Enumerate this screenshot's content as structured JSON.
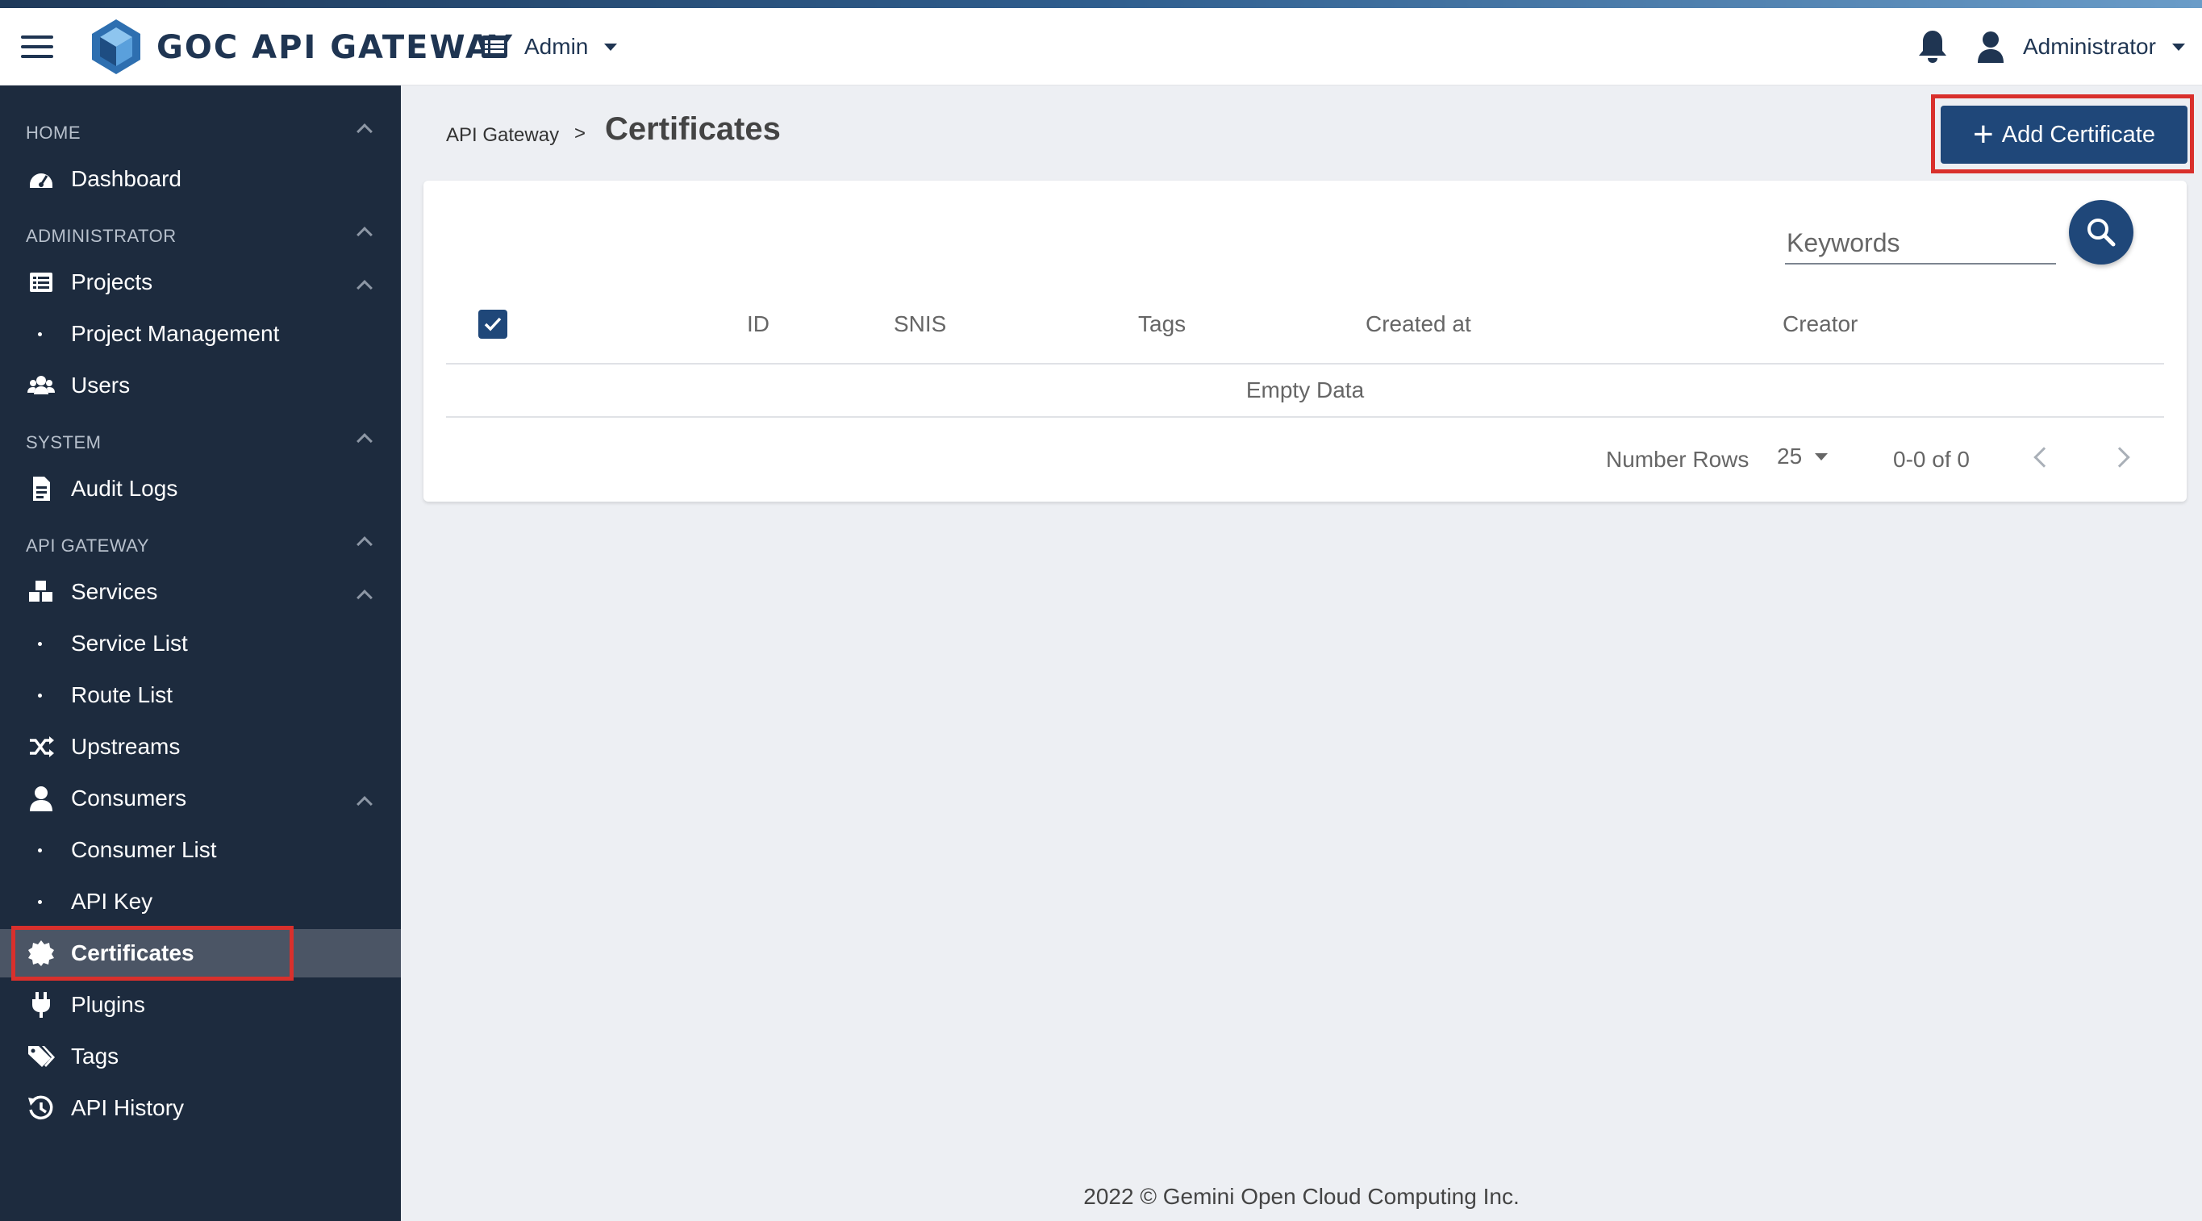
{
  "header": {
    "brand": "GOC API GATEWAY",
    "switcher_label": "Admin",
    "user_label": "Administrator"
  },
  "sidebar": {
    "sections": [
      "HOME",
      "ADMINISTRATOR",
      "SYSTEM",
      "API GATEWAY"
    ],
    "items": [
      {
        "label": "Dashboard",
        "icon": "dashboard-icon"
      },
      {
        "label": "Projects",
        "icon": "list-icon"
      },
      {
        "label": "Project Management",
        "icon": "bullet"
      },
      {
        "label": "Users",
        "icon": "users-icon"
      },
      {
        "label": "Audit Logs",
        "icon": "document-icon"
      },
      {
        "label": "Services",
        "icon": "cubes-icon"
      },
      {
        "label": "Service List",
        "icon": "bullet"
      },
      {
        "label": "Route List",
        "icon": "bullet"
      },
      {
        "label": "Upstreams",
        "icon": "shuffle-icon"
      },
      {
        "label": "Consumers",
        "icon": "user-icon"
      },
      {
        "label": "Consumer List",
        "icon": "bullet"
      },
      {
        "label": "API Key",
        "icon": "bullet"
      },
      {
        "label": "Certificates",
        "icon": "certificate-icon",
        "active": true
      },
      {
        "label": "Plugins",
        "icon": "plug-icon"
      },
      {
        "label": "Tags",
        "icon": "tags-icon"
      },
      {
        "label": "API History",
        "icon": "history-icon"
      }
    ]
  },
  "breadcrumb": {
    "parent": "API Gateway",
    "separator": ">",
    "current": "Certificates"
  },
  "add_button": "Add Certificate",
  "search": {
    "placeholder": "Keywords"
  },
  "table": {
    "columns": [
      "ID",
      "SNIS",
      "Tags",
      "Created at",
      "Creator"
    ],
    "empty_text": "Empty Data"
  },
  "pagination": {
    "rows_label": "Number Rows",
    "rows_value": "25",
    "range": "0-0 of 0"
  },
  "footer": "2022 © Gemini Open Cloud Computing Inc.",
  "colors": {
    "sidebar": "#1d2b3e",
    "primary": "#1f4779",
    "highlight": "#d9302c"
  }
}
